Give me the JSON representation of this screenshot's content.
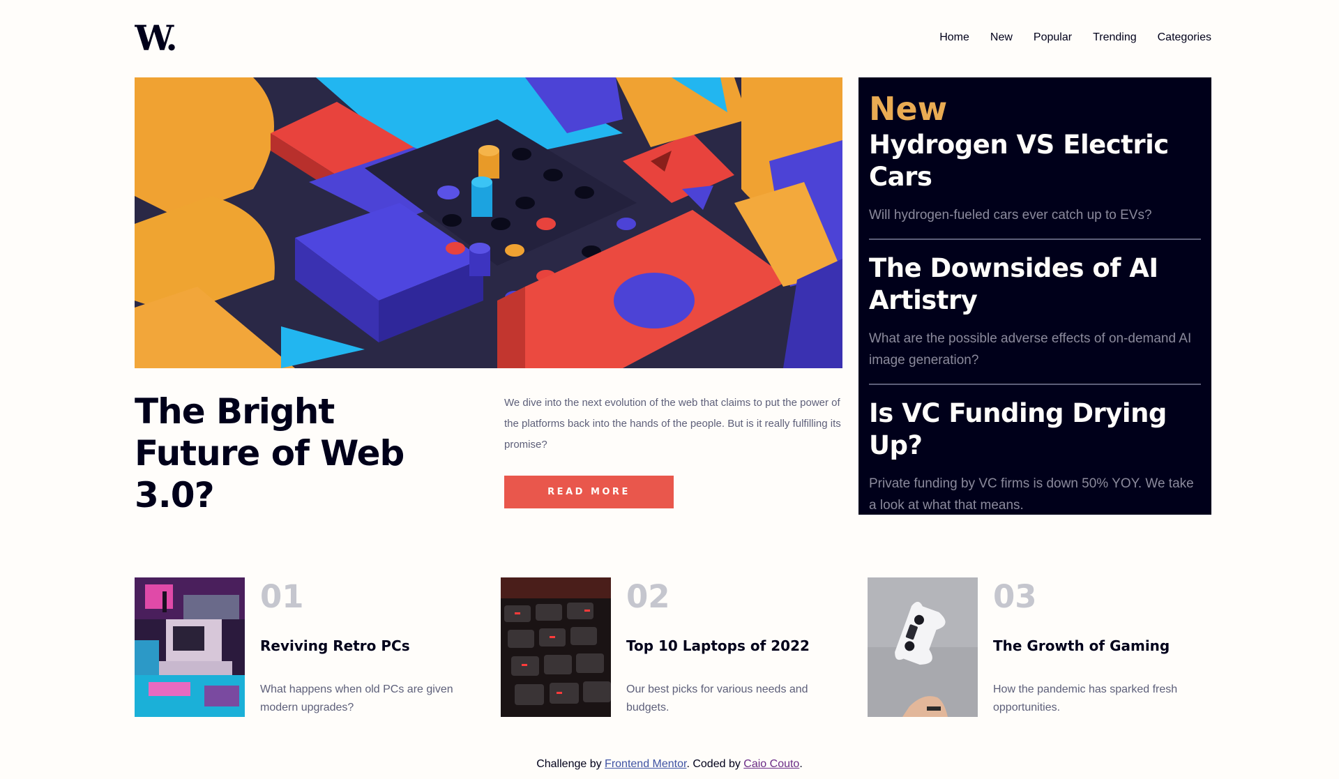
{
  "logo": {
    "text": "W."
  },
  "nav": {
    "items": [
      "Home",
      "New",
      "Popular",
      "Trending",
      "Categories"
    ]
  },
  "hero": {
    "image_icon": "abstract-3d-blocks-image",
    "title": "The Bright Future of Web 3.0?",
    "description": "We dive into the next evolution of the web that claims to put the power of the platforms back into the hands of the people. But is it really fulfilling its promise?",
    "button_label": "READ MORE"
  },
  "new_panel": {
    "heading": "New",
    "items": [
      {
        "title": "Hydrogen VS Electric Cars",
        "description": "Will hydrogen-fueled cars ever catch up to EVs?"
      },
      {
        "title": "The Downsides of AI Artistry",
        "description": "What are the possible adverse effects of on-demand AI image generation?"
      },
      {
        "title": "Is VC Funding Drying Up?",
        "description": "Private funding by VC firms is down 50% YOY. We take a look at what that means."
      }
    ]
  },
  "cards": [
    {
      "number": "01",
      "title": "Reviving Retro PCs",
      "description": "What happens when old PCs are given modern upgrades?",
      "image_icon": "retro-pc-image"
    },
    {
      "number": "02",
      "title": "Top 10 Laptops of 2022",
      "description": "Our best picks for various needs and budgets.",
      "image_icon": "keyboard-image"
    },
    {
      "number": "03",
      "title": "The Growth of Gaming",
      "description": "How the pandemic has sparked fresh opportunities.",
      "image_icon": "game-controller-image"
    }
  ],
  "footer": {
    "prefix": "Challenge by ",
    "link1": "Frontend Mentor",
    "middle": ". Coded by ",
    "link2": "Caio Couto",
    "suffix": "."
  },
  "colors": {
    "accent_orange": "#e9ab53",
    "button_red": "#e9574c",
    "dark_navy": "#00001a",
    "off_white": "#fffdfa",
    "grayish_blue": "#5d5f79"
  }
}
